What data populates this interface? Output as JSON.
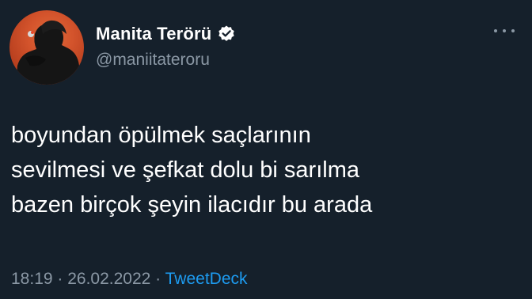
{
  "author": {
    "display_name": "Manita Terörü",
    "handle": "@maniitateroru",
    "verified_icon": "verified-badge-icon",
    "avatar_icon": "avatar-illustration"
  },
  "tweet": {
    "lines": [
      "boyundan öpülmek saçlarının",
      "sevilmesi ve şefkat dolu bi sarılma",
      "bazen birçok şeyin ilacıdır bu arada"
    ]
  },
  "meta": {
    "time": "18:19",
    "separator_1": " · ",
    "date": "26.02.2022",
    "separator_2": " · ",
    "source": "TweetDeck"
  },
  "colors": {
    "background": "#15202b",
    "text": "#ffffff",
    "secondary": "#8b98a5",
    "link": "#1d9bf0"
  },
  "more_icon": "more-options-icon"
}
